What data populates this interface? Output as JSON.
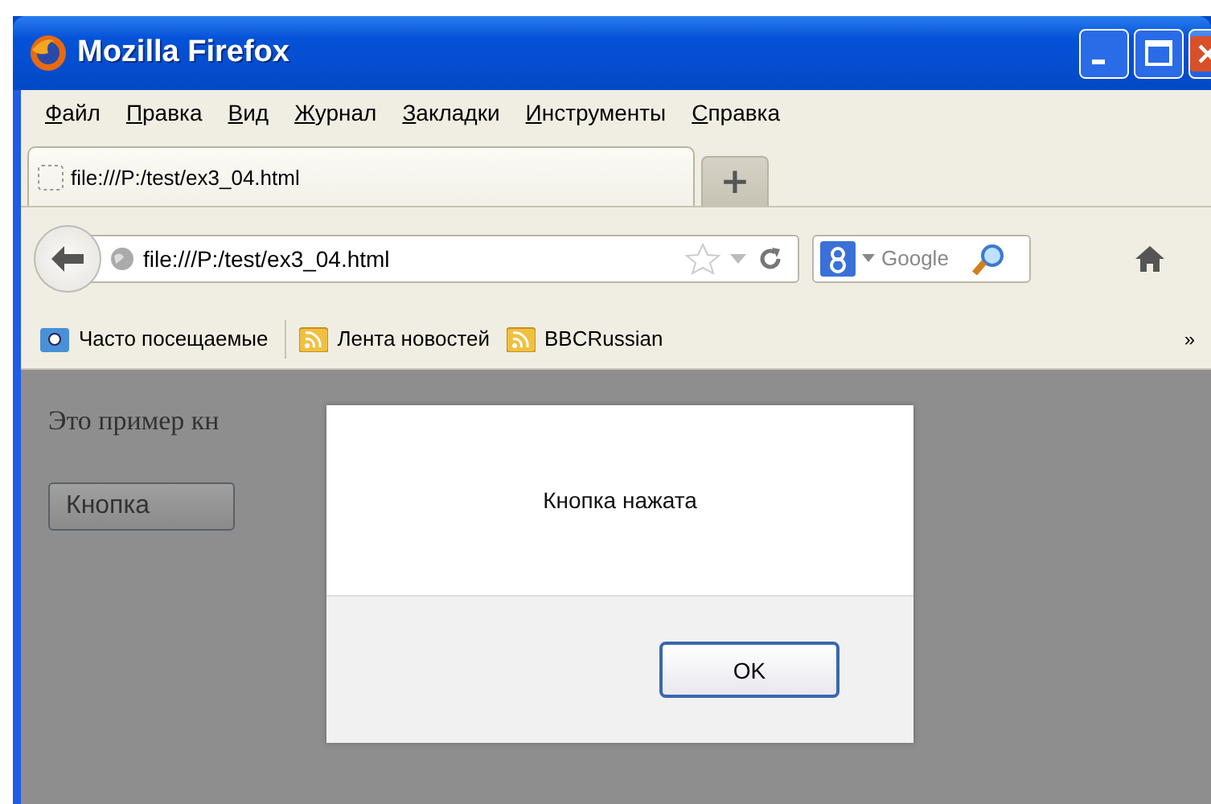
{
  "window": {
    "title": "Mozilla Firefox"
  },
  "menu": [
    {
      "label": "Файл"
    },
    {
      "label": "Правка"
    },
    {
      "label": "Вид"
    },
    {
      "label": "Журнал"
    },
    {
      "label": "Закладки"
    },
    {
      "label": "Инструменты"
    },
    {
      "label": "Справка"
    }
  ],
  "tabs": [
    {
      "label": "file:///P:/test/ex3_04.html",
      "selected": true
    }
  ],
  "new_tab": {
    "label": "+"
  },
  "address_bar": {
    "value": "file:///P:/test/ex3_04.html"
  },
  "search": {
    "placeholder": "Google"
  },
  "bookmarks": [
    {
      "label": "Часто посещаемые",
      "kind": "folder"
    },
    {
      "label": "Лента новостей",
      "kind": "feed"
    },
    {
      "label": "BBCRussian",
      "kind": "feed"
    }
  ],
  "bookmarks_overflow": "»",
  "page": {
    "text": "Это пример кн",
    "button": "Кнопка"
  },
  "dialog": {
    "message": "Кнопка нажата",
    "button": "OK"
  }
}
